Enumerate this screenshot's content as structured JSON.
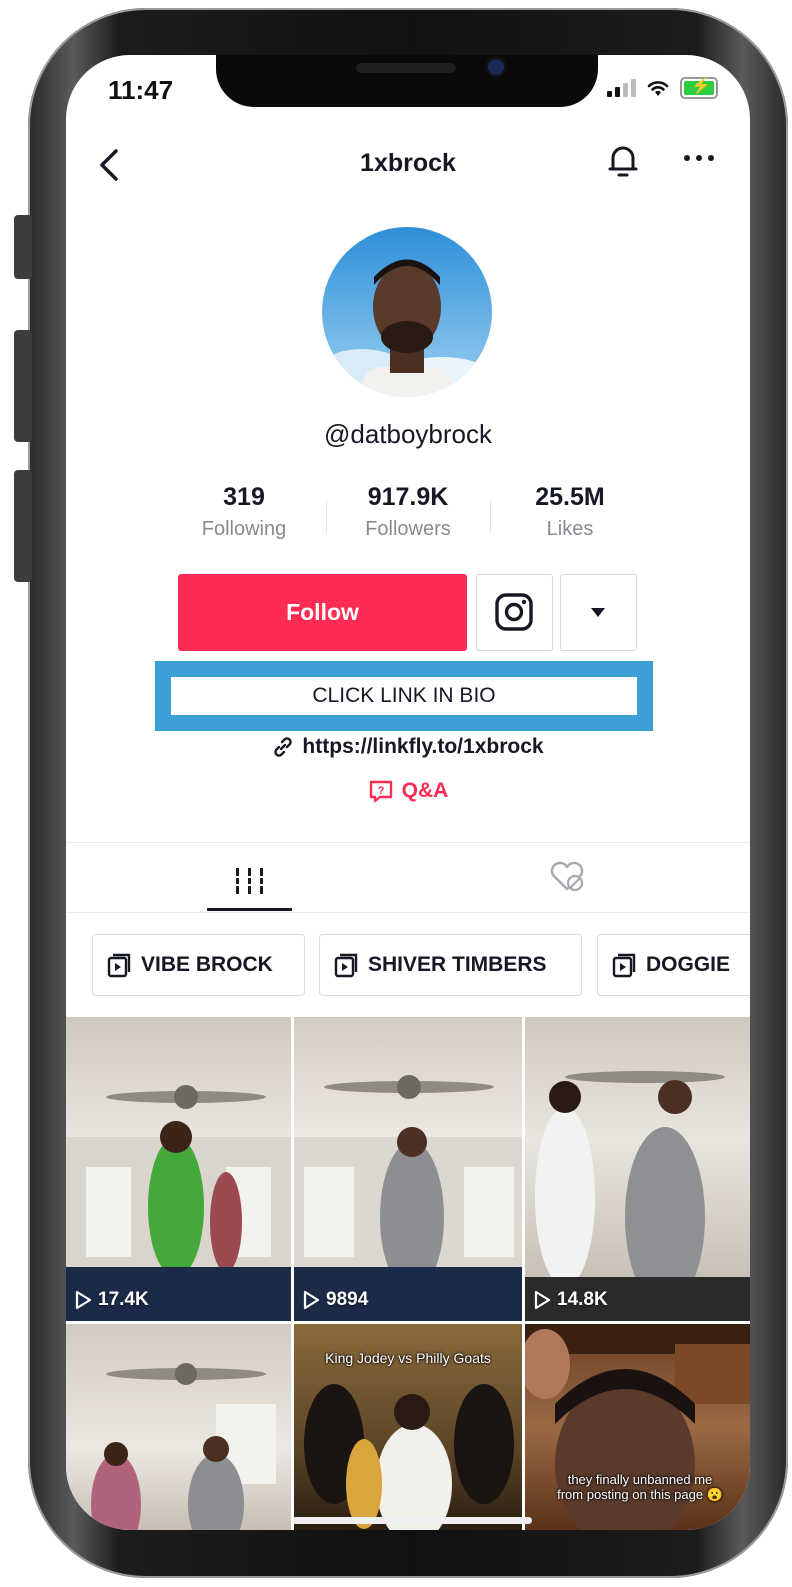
{
  "status_bar": {
    "time": "11:47"
  },
  "header": {
    "title": "1xbrock"
  },
  "profile": {
    "handle": "@datboybrock",
    "stats": [
      {
        "value": "319",
        "label": "Following"
      },
      {
        "value": "917.9K",
        "label": "Followers"
      },
      {
        "value": "25.5M",
        "label": "Likes"
      }
    ],
    "follow_label": "Follow",
    "bio": "CLICK LINK IN BIO",
    "link": "https://linkfly.to/1xbrock",
    "qa_label": "Q&A"
  },
  "tabs": [
    "videos-grid",
    "liked-hidden"
  ],
  "playlists": [
    "VIBE BROCK",
    "SHIVER TIMBERS",
    "DOGGIE"
  ],
  "videos": [
    {
      "views": "17.4K",
      "caption": ""
    },
    {
      "views": "9894",
      "caption": ""
    },
    {
      "views": "14.8K",
      "caption": ""
    },
    {
      "views": "",
      "caption": ""
    },
    {
      "views": "",
      "caption": "King Jodey vs Philly Goats"
    },
    {
      "views": "",
      "caption": "they finally unbanned me from posting on this page 😮"
    }
  ],
  "colors": {
    "accent": "#fe2c55",
    "highlight_box": "#3d9fd8",
    "text": "#161823",
    "muted": "#8a8b91"
  }
}
